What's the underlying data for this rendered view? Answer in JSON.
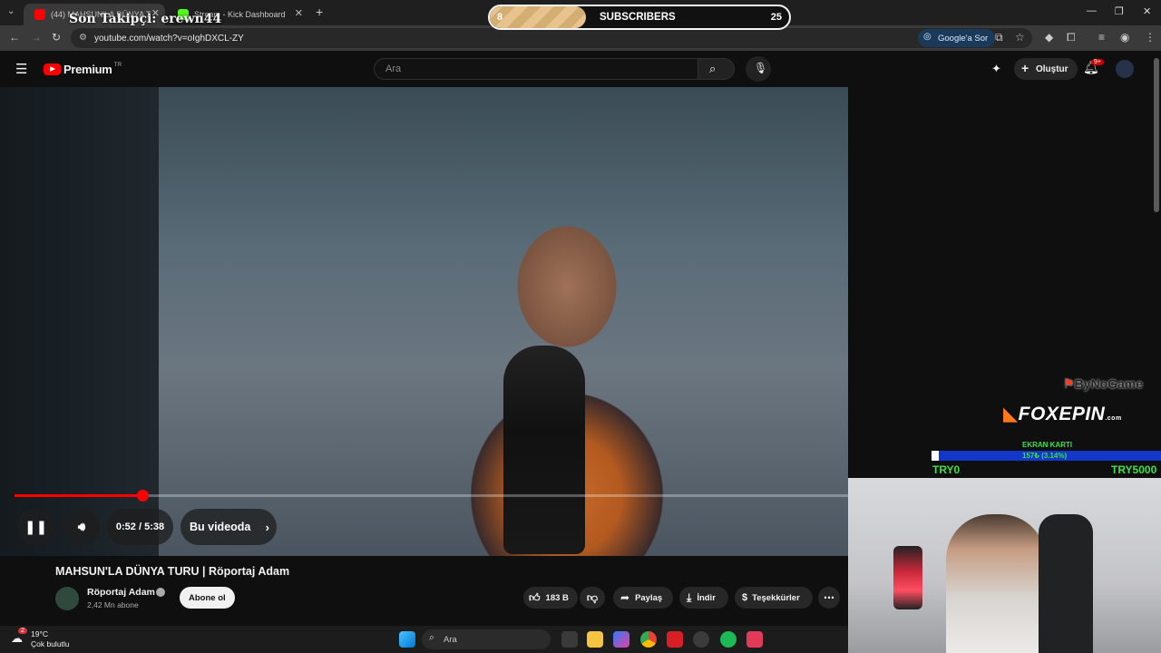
{
  "browser": {
    "tabs": [
      {
        "label": "(44) MAHSUN'LA DÜNYA T",
        "active": true
      },
      {
        "label": "Stream - Kick Dashboard",
        "active": false
      }
    ],
    "url": "youtube.com/watch?v=oIghDXCL-ZY",
    "google_sor_label": "Google'a Sor"
  },
  "youtube": {
    "logo_label": "Premium",
    "region": "TR",
    "search_placeholder": "Ara",
    "create_label": "Oluştur",
    "notif_badge": "9+"
  },
  "player": {
    "time": "0:52 / 5:38",
    "in_video_label": "Bu videoda",
    "progress": 0.1538
  },
  "video": {
    "title": "MAHSUN'LA DÜNYA TURU | Röportaj Adam",
    "channel": "Röportaj Adam",
    "subscribers": "2,42 Mn abone",
    "subscribe_label": "Abone ol",
    "likes": "183 B",
    "share_label": "Paylaş",
    "download_label": "İndir",
    "thanks_label": "Teşekkürler"
  },
  "overlays": {
    "last_follower": "Son Takipçi: erewn44",
    "sub_goal_current": "8",
    "sub_goal_label": "SUBSCRIBERS",
    "sub_goal_target": "25",
    "sub_goal_progress": 0.32,
    "sponsor_top": "ByNoGame",
    "sponsor_main": "FOXEPIN",
    "sponsor_main_suffix": ".com",
    "goal_title": "EKRAN KARTI",
    "goal_value": "157₺ (3.14%)",
    "goal_min": "TRY0",
    "goal_max": "TRY5000",
    "goal_progress": 0.0314
  },
  "taskbar": {
    "weather_temp": "19°C",
    "weather_desc": "Çok bulutlu",
    "weather_badge": "2",
    "search_label": "Ara"
  },
  "colors": {
    "youtube_red": "#ff0000",
    "goal_blue": "#1237c9",
    "goal_green": "#3ce04b"
  }
}
